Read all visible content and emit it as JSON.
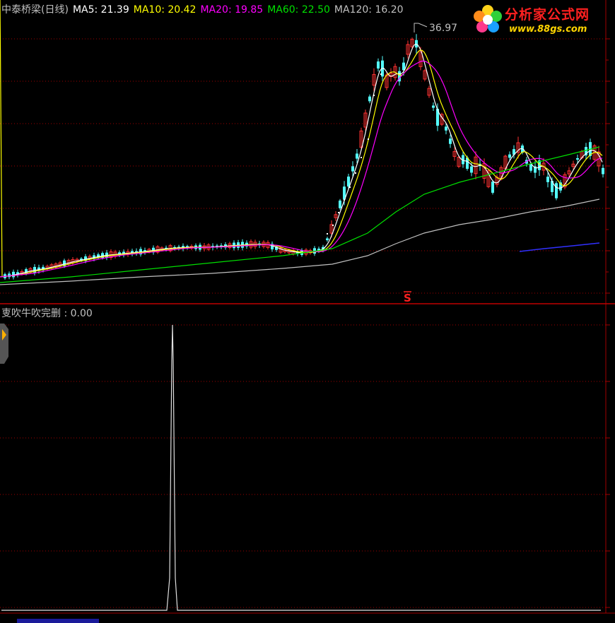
{
  "header": {
    "stock": "中泰桥梁(日线)",
    "ma5": "MA5: 21.39",
    "ma10": "MA10: 20.42",
    "ma20": "MA20: 19.85",
    "ma60": "MA60: 22.50",
    "ma120": "MA120: 16.20"
  },
  "peak_label": "36.97",
  "signal_marker": "S",
  "indicator": {
    "title": "叓吹牛吹完删 : 0.00"
  },
  "logo": {
    "title": "分析家公式网",
    "url": "www.88gs.com"
  },
  "colors": {
    "background": "#000000",
    "up": "#ff3232",
    "down": "#54ffff",
    "ma5": "#ffffff",
    "ma10": "#ffff00",
    "ma20": "#ff00ff",
    "ma60": "#00e000",
    "ma120": "#c0c0c0",
    "grid": "#a00000",
    "blue": "#3030ff"
  },
  "chart_data": [
    {
      "type": "candlestick",
      "title": "中泰桥梁(日线)",
      "series": [
        {
          "name": "MA5",
          "value": 21.39
        },
        {
          "name": "MA10",
          "value": 20.42
        },
        {
          "name": "MA20",
          "value": 19.85
        },
        {
          "name": "MA60",
          "value": 22.5
        },
        {
          "name": "MA120",
          "value": 16.2
        }
      ],
      "annotations": [
        {
          "label": "36.97",
          "type": "high"
        }
      ]
    },
    {
      "type": "line",
      "title": "叓吹牛吹完删 : 0.00",
      "peak_value": 1,
      "current_value": 0.0
    }
  ]
}
